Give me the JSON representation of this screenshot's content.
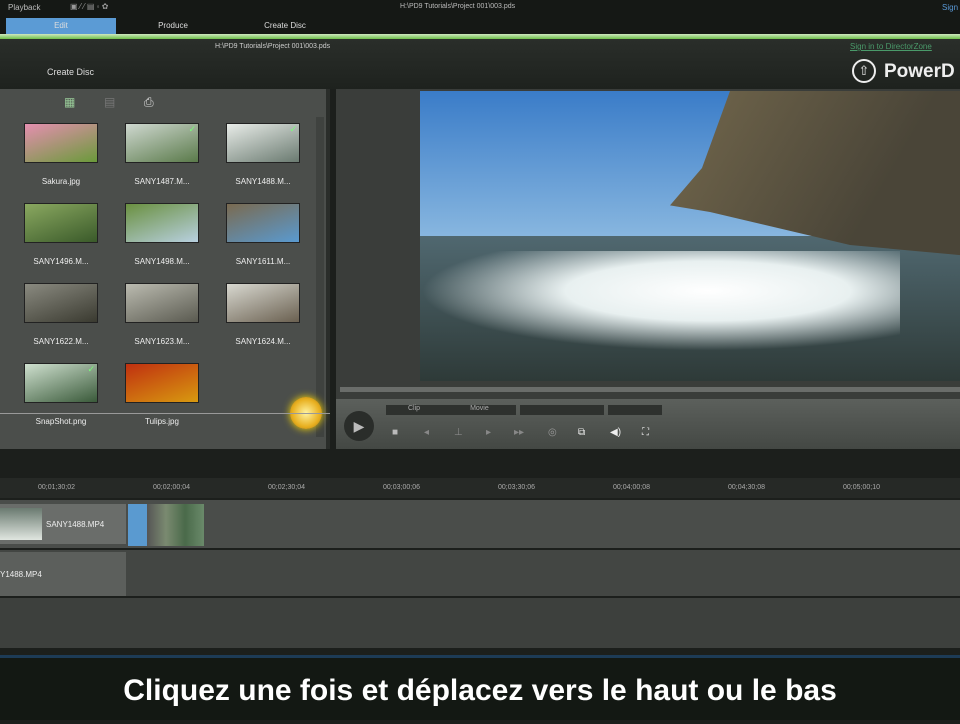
{
  "topbar": {
    "menu": "Playback",
    "title": "H:\\PD9 Tutorials\\Project 001\\003.pds",
    "sign": "Sign",
    "tabs": [
      "Edit",
      "Produce",
      "Create Disc"
    ]
  },
  "header": {
    "path": "H:\\PD9 Tutorials\\Project 001\\003.pds",
    "section": "Create Disc",
    "signin": "Sign in to DirectorZone",
    "logo": "PowerD"
  },
  "library": {
    "items": [
      {
        "name": "Sakura.jpg",
        "colors": [
          "#6a9a3a",
          "#e58fb0"
        ],
        "check": false
      },
      {
        "name": "SANY1487.M...",
        "colors": [
          "#5a7a4a",
          "#cfd8d0"
        ],
        "check": true
      },
      {
        "name": "SANY1488.M...",
        "colors": [
          "#6a7a70",
          "#e8ece8"
        ],
        "check": true
      },
      {
        "name": "SANY1496.M...",
        "colors": [
          "#3a5a2a",
          "#8aa860"
        ],
        "check": false
      },
      {
        "name": "SANY1498.M...",
        "colors": [
          "#b8d0e0",
          "#6a9040"
        ],
        "check": false
      },
      {
        "name": "SANY1611.M...",
        "colors": [
          "#5a9ad0",
          "#7a6a50"
        ],
        "check": false
      },
      {
        "name": "SANY1622.M...",
        "colors": [
          "#3a3a30",
          "#8a8a80"
        ],
        "check": false
      },
      {
        "name": "SANY1623.M...",
        "colors": [
          "#5a5a50",
          "#bbbbb0"
        ],
        "check": false
      },
      {
        "name": "SANY1624.M...",
        "colors": [
          "#6a6050",
          "#d8d8d0"
        ],
        "check": false
      },
      {
        "name": "SnapShot.png",
        "colors": [
          "#3a5a3a",
          "#cfe0cf"
        ],
        "check": true
      },
      {
        "name": "Tulips.jpg",
        "colors": [
          "#d89a10",
          "#c03010"
        ],
        "check": false
      }
    ]
  },
  "preview": {
    "tabs": [
      "Clip",
      "Movie"
    ]
  },
  "timeline": {
    "timecodes": [
      "00;01;30;02",
      "00;02;00;04",
      "00;02;30;04",
      "00;03;00;06",
      "00;03;30;06",
      "00;04;00;08",
      "00;04;30;08",
      "00;05;00;10"
    ],
    "clip1": "SANY1488.MP4",
    "clip2": "Y1488.MP4"
  },
  "subtitle": "Cliquez une fois et déplacez vers le haut ou le bas"
}
